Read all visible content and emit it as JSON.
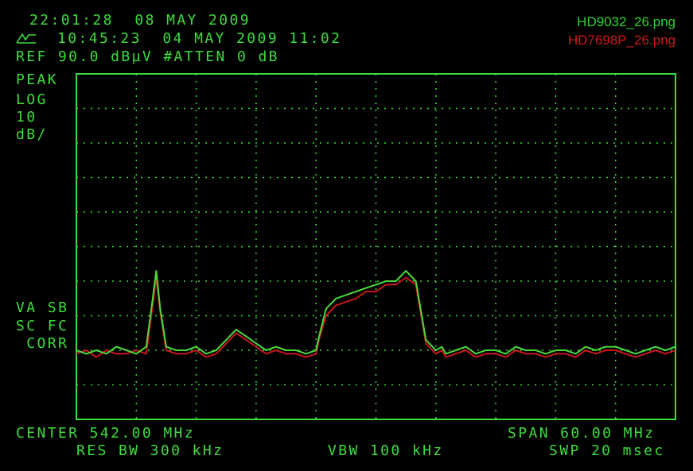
{
  "header": {
    "time_line": "22:01:28  08 MAY 2009",
    "trace_line": "10:45:23  04 MAY 2009 11:02",
    "ref_line": "REF 90.0 dBµV #ATTEN 0 dB"
  },
  "files": {
    "trace_a": {
      "name": "HD9032_26.png",
      "color": "#2ed42e"
    },
    "trace_b": {
      "name": "HD7698P_26.png",
      "color": "#cc1a1a"
    }
  },
  "left_annotations": {
    "mode": "PEAK",
    "scale": "LOG",
    "per_div": "10",
    "unit": "dB/",
    "va_sb": "VA SB",
    "sc_fc": "SC FC",
    "corr": " CORR"
  },
  "footer": {
    "center": "CENTER 542.00 MHz",
    "span": "SPAN 60.00 MHz",
    "res_bw": "RES BW 300 kHz",
    "vbw": "VBW 100 kHz",
    "swp": "SWP 20 msec"
  },
  "colors": {
    "screen_text": "#3ddc3d",
    "grid": "#3ddc3d"
  },
  "chart_data": {
    "type": "line",
    "xlim": [
      512,
      572
    ],
    "ylim": [
      -10,
      90
    ],
    "xunit": "MHz",
    "yunit": "dBµV",
    "grid": true,
    "divisions": {
      "x": 10,
      "y": 10
    },
    "series": [
      {
        "name": "HD9032_26.png",
        "color": "#4cd83c",
        "x": [
          512,
          513,
          514,
          515,
          516,
          517,
          518,
          519,
          519.6,
          520,
          520.4,
          521,
          522,
          523,
          524,
          525,
          526,
          527,
          528,
          529,
          530,
          531,
          532,
          533,
          534,
          535,
          536,
          536.3,
          537,
          538,
          539,
          540,
          541,
          542,
          543,
          544,
          545,
          546,
          547,
          548,
          548.6,
          549,
          550,
          551,
          552,
          553,
          554,
          555,
          556,
          557,
          558,
          559,
          560,
          561,
          562,
          563,
          564,
          565,
          566,
          567,
          568,
          569,
          570,
          571,
          572
        ],
        "y": [
          10,
          9,
          10,
          9,
          11,
          10,
          9,
          11,
          24,
          33,
          22,
          11,
          10,
          10,
          11,
          9,
          10,
          13,
          16,
          14,
          12,
          10,
          11,
          10,
          10,
          9,
          10,
          14,
          22,
          25,
          26,
          27,
          28,
          29,
          30,
          30,
          33,
          30,
          13,
          10,
          11,
          9,
          10,
          11,
          9,
          10,
          10,
          9,
          11,
          10,
          10,
          9,
          10,
          10,
          9,
          11,
          10,
          11,
          11,
          10,
          9,
          10,
          11,
          10,
          11
        ]
      },
      {
        "name": "HD7698P_26.png",
        "color": "#c8161c",
        "x": [
          512,
          513,
          514,
          515,
          516,
          517,
          518,
          519,
          519.6,
          520,
          520.4,
          521,
          522,
          523,
          524,
          525,
          526,
          527,
          528,
          529,
          530,
          531,
          532,
          533,
          534,
          535,
          536,
          536.3,
          537,
          538,
          539,
          540,
          541,
          542,
          543,
          544,
          545,
          546,
          547,
          548,
          548.6,
          549,
          550,
          551,
          552,
          553,
          554,
          555,
          556,
          557,
          558,
          559,
          560,
          561,
          562,
          563,
          564,
          565,
          566,
          567,
          568,
          569,
          570,
          571,
          572
        ],
        "y": [
          9,
          10,
          8,
          10,
          9,
          9,
          10,
          9,
          22,
          31,
          21,
          10,
          9,
          9,
          10,
          8,
          9,
          12,
          15,
          13,
          11,
          9,
          10,
          9,
          9,
          8,
          9,
          13,
          20,
          23,
          24,
          25,
          27,
          27,
          29,
          29,
          31,
          29,
          12,
          9,
          10,
          8,
          9,
          10,
          8,
          9,
          9,
          8,
          10,
          9,
          9,
          8,
          9,
          9,
          8,
          10,
          9,
          10,
          10,
          9,
          8,
          9,
          10,
          9,
          10
        ]
      }
    ]
  }
}
